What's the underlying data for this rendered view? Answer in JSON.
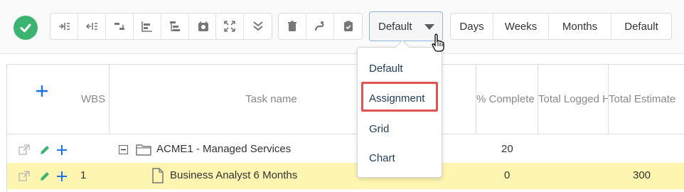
{
  "toolbar": {
    "view_selector": {
      "value": "Default"
    },
    "range_buttons": [
      "Days",
      "Weeks",
      "Months",
      "Default"
    ]
  },
  "grid": {
    "columns": {
      "wbs": "WBS",
      "task_name": "Task name",
      "complete": "% Complete",
      "logged": "Total Logged Hours",
      "estimate": "Total Estimate"
    },
    "rows": [
      {
        "wbs": "",
        "name": "ACME1 - Managed Services",
        "complete": "20",
        "estimate": ""
      },
      {
        "wbs": "1",
        "name": "Business Analyst 6 Months",
        "complete": "0",
        "estimate": "300"
      }
    ]
  },
  "dropdown": {
    "items": [
      "Default",
      "Assignment",
      "Grid",
      "Chart"
    ],
    "highlighted": "Assignment"
  },
  "colors": {
    "accent": "#3cb371",
    "link_blue": "#1a73e8",
    "highlight_row": "#fdf5b0",
    "callout_red": "#e05252"
  }
}
